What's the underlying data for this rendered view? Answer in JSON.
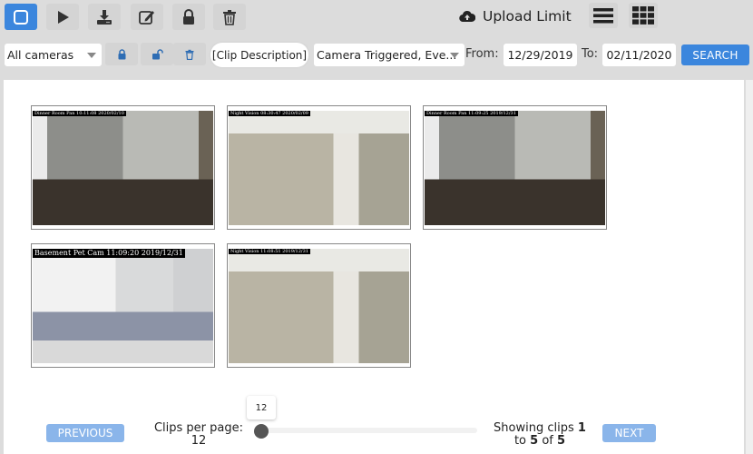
{
  "toolbar": {
    "buttons": [
      {
        "name": "select-all",
        "icon": "square-icon",
        "active": true
      },
      {
        "name": "play",
        "icon": "play-icon"
      },
      {
        "name": "download",
        "icon": "download-icon"
      },
      {
        "name": "edit",
        "icon": "edit-icon"
      },
      {
        "name": "lock",
        "icon": "lock-icon"
      },
      {
        "name": "delete",
        "icon": "trash-icon"
      }
    ],
    "upload_limit_label": "Upload Limit",
    "view_list_icon": "list-view-icon",
    "view_grid_icon": "grid-view-icon"
  },
  "filters": {
    "camera_select": "All cameras",
    "clip_description": "[Clip Description]",
    "trigger_select": "Camera Triggered, Eve...",
    "from_label": "From:",
    "from_date": "12/29/2019",
    "to_label": "To:",
    "to_date": "02/11/2020",
    "search_label": "SEARCH"
  },
  "clips": [
    {
      "stamp": "Dinner Room Pan 10:11:08 2020/02/10",
      "scene": "dining"
    },
    {
      "stamp": "Night Vision 08:30:47 2020/02/09",
      "scene": "living"
    },
    {
      "stamp": "Dinner Room Pan 11:09:25 2019/12/31",
      "scene": "dining"
    },
    {
      "stamp": "Basement Pet Cam 11:09:20 2019/12/31",
      "scene": "basement"
    },
    {
      "stamp": "Night Vision 11:08:51 2019/12/31",
      "scene": "living"
    }
  ],
  "pagination": {
    "previous_label": "PREVIOUS",
    "next_label": "NEXT",
    "clips_per_page_label": "Clips per page:",
    "clips_per_page_value": "12",
    "slider_tooltip": "12",
    "showing_prefix": "Showing clips",
    "showing_from": "1",
    "showing_to_word": "to",
    "showing_to": "5",
    "showing_of_word": "of",
    "showing_total": "5"
  },
  "colors": {
    "accent": "#3b86dd",
    "pager_button": "#8ab5ea",
    "toolbar_bg": "#dcdcdc"
  }
}
